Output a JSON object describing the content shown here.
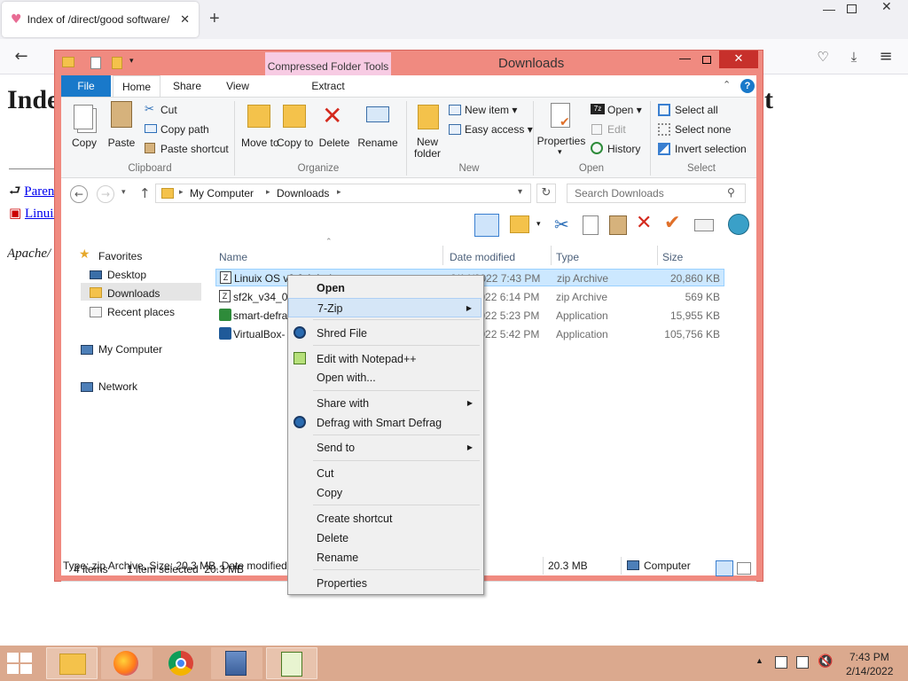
{
  "browser": {
    "tab_title": "Index of /direct/good software/",
    "new_tab": "+",
    "page_heading": "Index of /direct/good software/",
    "parent_link": "Parent Directory",
    "file_link": "Linuix OS v",
    "footer": "Apache/"
  },
  "explorer": {
    "title": "Downloads",
    "context_tab": "Compressed Folder Tools",
    "tabs": [
      "File",
      "Home",
      "Share",
      "View",
      "Extract"
    ],
    "ribbon": {
      "clipboard": {
        "copy": "Copy",
        "paste": "Paste",
        "cut": "Cut",
        "copy_path": "Copy path",
        "paste_shortcut": "Paste shortcut",
        "title": "Clipboard"
      },
      "organize": {
        "move_to": "Move to",
        "copy_to": "Copy to",
        "delete": "Delete",
        "rename": "Rename",
        "title": "Organize"
      },
      "new": {
        "new_folder": "New folder",
        "new_item": "New item",
        "easy_access": "Easy access",
        "title": "New"
      },
      "open": {
        "properties": "Properties",
        "open": "Open",
        "edit": "Edit",
        "history": "History",
        "title": "Open"
      },
      "select": {
        "select_all": "Select all",
        "select_none": "Select none",
        "invert": "Invert selection",
        "title": "Select"
      }
    },
    "address": {
      "part1": "My Computer",
      "part2": "Downloads"
    },
    "search_placeholder": "Search Downloads",
    "nav": {
      "favorites": "Favorites",
      "desktop": "Desktop",
      "downloads": "Downloads",
      "recent": "Recent places",
      "computer": "My Computer",
      "network": "Network"
    },
    "columns": {
      "name": "Name",
      "date": "Date modified",
      "type": "Type",
      "size": "Size"
    },
    "files": [
      {
        "name": "Linuix OS v0.0.1.1.zip",
        "date": "2/14/2022 7:43 PM",
        "type": "zip Archive",
        "size": "20,860 KB"
      },
      {
        "name": "sf2k_v34_0",
        "date": "2/14/2022 6:14 PM",
        "type": "zip Archive",
        "size": "569 KB"
      },
      {
        "name": "smart-defrag",
        "date": "2/14/2022 5:23 PM",
        "type": "Application",
        "size": "15,955 KB"
      },
      {
        "name": "VirtualBox-",
        "date": "2/14/2022 5:42 PM",
        "type": "Application",
        "size": "105,756 KB"
      }
    ],
    "status": {
      "items": "4 items",
      "selected": "1 item selected  20.3 MB"
    },
    "details": {
      "info": "Type: zip Archive, Size: 20.3 MB, Date modified: ",
      "size": "20.3 MB",
      "location": "Computer"
    }
  },
  "context_menu": {
    "items": [
      "Open",
      "7-Zip",
      "Shred File",
      "Edit with Notepad++",
      "Open with...",
      "Share with",
      "Defrag with Smart Defrag",
      "Send to",
      "Cut",
      "Copy",
      "Create shortcut",
      "Delete",
      "Rename",
      "Properties"
    ]
  },
  "taskbar": {
    "time": "7:43 PM",
    "date": "2/14/2022"
  },
  "colors": {
    "window_frame": "#f08a80",
    "file_tab": "#1979ca",
    "selection": "#cce8ff",
    "taskbar": "#dba98e"
  }
}
